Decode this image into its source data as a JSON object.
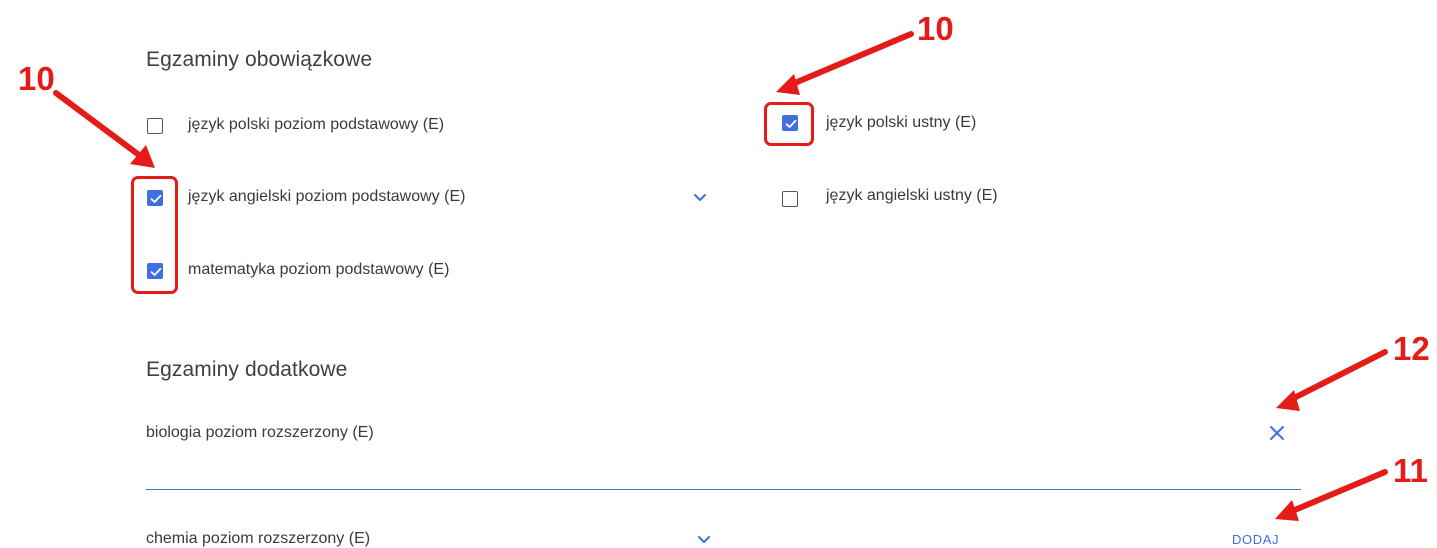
{
  "mandatory": {
    "heading": "Egzaminy obowiązkowe",
    "exams": [
      {
        "label": "język polski poziom podstawowy (E)",
        "checked": false
      },
      {
        "label": "język angielski poziom podstawowy (E)",
        "checked": true
      },
      {
        "label": "matematyka poziom podstawowy (E)",
        "checked": true
      },
      {
        "label": "język polski ustny (E)",
        "checked": true
      },
      {
        "label": "język angielski ustny (E)",
        "checked": false
      }
    ]
  },
  "additional": {
    "heading": "Egzaminy dodatkowe",
    "selected_exam": "biologia poziom rozszerzony (E)",
    "new_exam_select_value": "chemia poziom rozszerzony (E)",
    "add_button_label": "DODAJ"
  },
  "annotations": {
    "callout_left": "10",
    "callout_top": "10",
    "callout_remove": "12",
    "callout_add": "11"
  },
  "colors": {
    "accent": "#3f6fe0",
    "annotation_red": "#e41b17"
  },
  "icons": [
    "checkbox-checked-icon",
    "checkbox-empty-icon",
    "chevron-down-icon",
    "close-icon",
    "red-arrow"
  ]
}
